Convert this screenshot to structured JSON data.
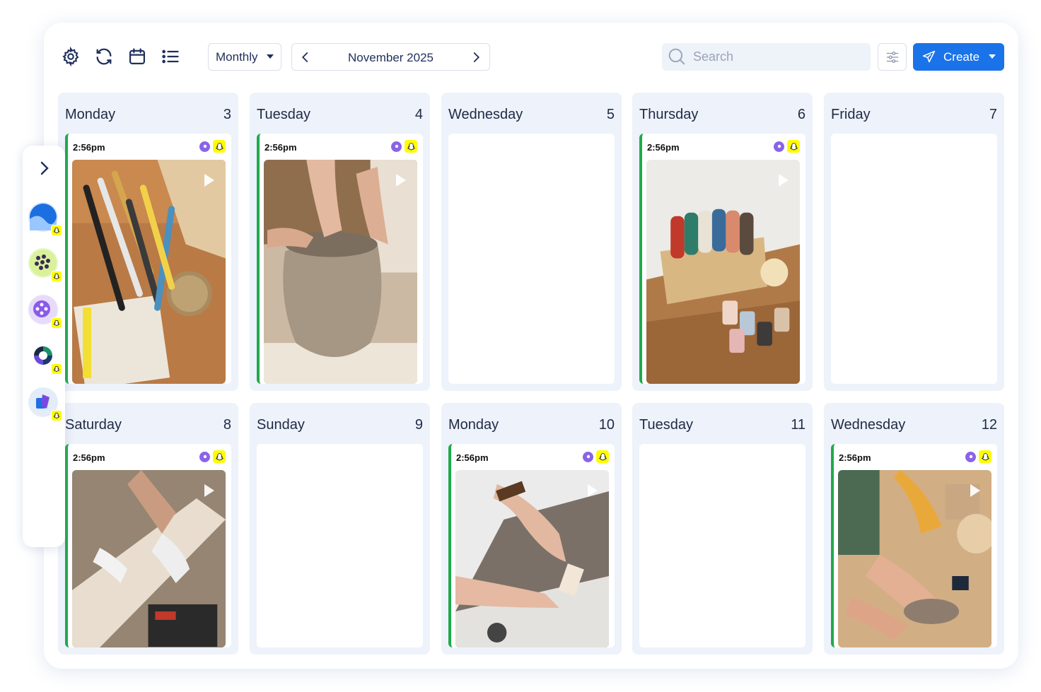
{
  "toolbar": {
    "icons": [
      "gear-icon",
      "refresh-icon",
      "calendar-icon",
      "list-icon"
    ],
    "view_select": "Monthly",
    "period_label": "November 2025",
    "search_placeholder": "Search",
    "create_label": "Create"
  },
  "accent_colors": {
    "primary": "#1a73e8",
    "scheduled_bar": "#1faa4a",
    "snapchat": "#fffc00",
    "platform_badge": "#8a63e8"
  },
  "weeks": [
    [
      {
        "day": "Monday",
        "date": "3",
        "post": {
          "time": "2:56pm",
          "image": "craft-tools-photo"
        }
      },
      {
        "day": "Tuesday",
        "date": "4",
        "post": {
          "time": "2:56pm",
          "image": "clay-vase-photo"
        }
      },
      {
        "day": "Wednesday",
        "date": "5",
        "post": null
      },
      {
        "day": "Thursday",
        "date": "6",
        "post": {
          "time": "2:56pm",
          "image": "ribbon-spools-photo"
        }
      },
      {
        "day": "Friday",
        "date": "7",
        "post": null
      }
    ],
    [
      {
        "day": "Saturday",
        "date": "8",
        "post": {
          "time": "2:56pm",
          "image": "woodwork-photo"
        }
      },
      {
        "day": "Sunday",
        "date": "9",
        "post": null
      },
      {
        "day": "Monday",
        "date": "10",
        "post": {
          "time": "2:56pm",
          "image": "leather-craft-photo"
        }
      },
      {
        "day": "Tuesday",
        "date": "11",
        "post": null
      },
      {
        "day": "Wednesday",
        "date": "12",
        "post": {
          "time": "2:56pm",
          "image": "clay-kneading-photo"
        }
      }
    ]
  ],
  "accounts_rail": {
    "toggle_icon": "chevron-right-icon",
    "accounts": [
      "account-blue-avatar",
      "account-dots-avatar",
      "account-purple-avatar",
      "account-ring-avatar",
      "account-cube-avatar"
    ]
  }
}
